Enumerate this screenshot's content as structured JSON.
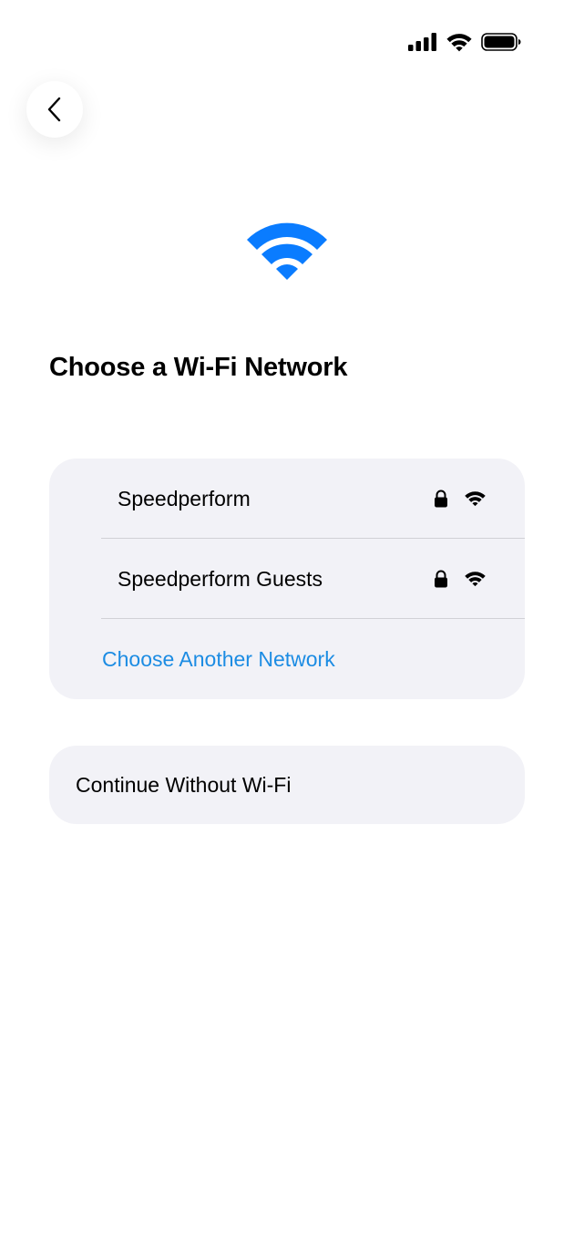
{
  "status_bar": {
    "signal_icon": "cellular-signal-icon",
    "wifi_icon": "wifi-icon",
    "battery_icon": "battery-icon"
  },
  "header": {
    "back_icon": "chevron-left-icon"
  },
  "hero": {
    "icon": "wifi-icon",
    "icon_color": "#0a7cff"
  },
  "title": "Choose a Wi-Fi Network",
  "networks": [
    {
      "name": "Speedperform",
      "lock_icon": "lock-icon",
      "signal_icon": "wifi-icon"
    },
    {
      "name": "Speedperform Guests",
      "lock_icon": "lock-icon",
      "signal_icon": "wifi-icon"
    }
  ],
  "other_network_label": "Choose Another Network",
  "continue_without_label": "Continue Without Wi-Fi",
  "colors": {
    "accent": "#1c8ce3",
    "card_background": "#f2f2f7",
    "text": "#000000"
  }
}
